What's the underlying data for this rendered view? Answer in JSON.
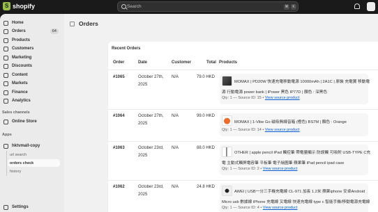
{
  "topbar": {
    "logo": "shopify",
    "search_placeholder": "Search",
    "shortcut_keys": [
      "⌘",
      "K"
    ]
  },
  "sidebar": {
    "items": [
      {
        "label": "Home",
        "icon": "home-icon"
      },
      {
        "label": "Orders",
        "icon": "inbox-icon",
        "badge": "64"
      },
      {
        "label": "Products",
        "icon": "tag-icon"
      },
      {
        "label": "Customers",
        "icon": "person-icon"
      },
      {
        "label": "Marketing",
        "icon": "target-icon"
      },
      {
        "label": "Discounts",
        "icon": "discount-icon"
      },
      {
        "label": "Content",
        "icon": "document-icon"
      },
      {
        "label": "Markets",
        "icon": "globe-icon"
      },
      {
        "label": "Finance",
        "icon": "bank-icon"
      },
      {
        "label": "Analytics",
        "icon": "chart-icon"
      }
    ],
    "sales_channels_label": "Sales channels",
    "online_store": "Online Store",
    "apps_label": "Apps",
    "app_name": "hktvmall-copy",
    "app_sub_items": [
      "url search",
      "orders check",
      "history"
    ],
    "settings": "Settings"
  },
  "main": {
    "title": "Orders",
    "card_title": "Recent Orders",
    "columns": [
      "Order",
      "Date",
      "Customer",
      "Total",
      "Products"
    ],
    "rows": [
      {
        "order": "#1065",
        "date_line1": "October 27th,",
        "date_line2": "2025",
        "customer": "N/A",
        "total": "79.0 HKD",
        "product_line1": "MOMAX | PD20W 快速充電移動電源 10000mAh | 2A1C | 原裝 充電寶 移動電",
        "product_line2": "源 行動電源 power bank | iPower 黑色 IP77D | 顏色 : 深黑色",
        "meta": "Qty: 1 — Source ID: 15 • ",
        "link": "View source product"
      },
      {
        "order": "#1064",
        "date_line1": "October 27th,",
        "date_line2": "2025",
        "customer": "N/A",
        "total": "99.0 HKD",
        "product_line1": "MOMAX | 1-Vibe Go 磁吸無線音箱 (橙色) BS7M | 顏色 : Orange",
        "product_line2": "",
        "meta": "Qty: 1 — Source ID: 14 • ",
        "link": "View source product"
      },
      {
        "order": "#1063",
        "date_line1": "October 23rd,",
        "date_line2": "2025",
        "customer": "N/A",
        "total": "88.0 HKD",
        "product_line1": "OTHER | apple pencil iPad 觸控筆 帶電量顯示 防誤觸 可吸附 USB-TYPE C充",
        "product_line2": "電 主動式觸屏電容筆 平板筆 電子繪圖筆 蘋果筆 iPad pencil ipad case",
        "meta": "Qty: 1 — Source ID: 2 • ",
        "link": "View source product"
      },
      {
        "order": "#1062",
        "date_line1": "October 23rd,",
        "date_line2": "2025",
        "customer": "N/A",
        "total": "24.8 HKD",
        "product_line1": "AWEI | USB一分三手機充電線 CL-971 加長 1.2米 蘋果iphone 安卓Android",
        "product_line2": "Micro usb 數據線 iPhone 充電線 叉電線 快速充電線 type c 智能手機/移動電源充電線",
        "meta": "Qty: 1 — Source ID: 4 • ",
        "link": "View source product"
      }
    ]
  },
  "colors": {
    "accent_link": "#005bd3",
    "sidebar_bg": "#ebebeb",
    "topbar_bg": "#1a1a1a"
  }
}
